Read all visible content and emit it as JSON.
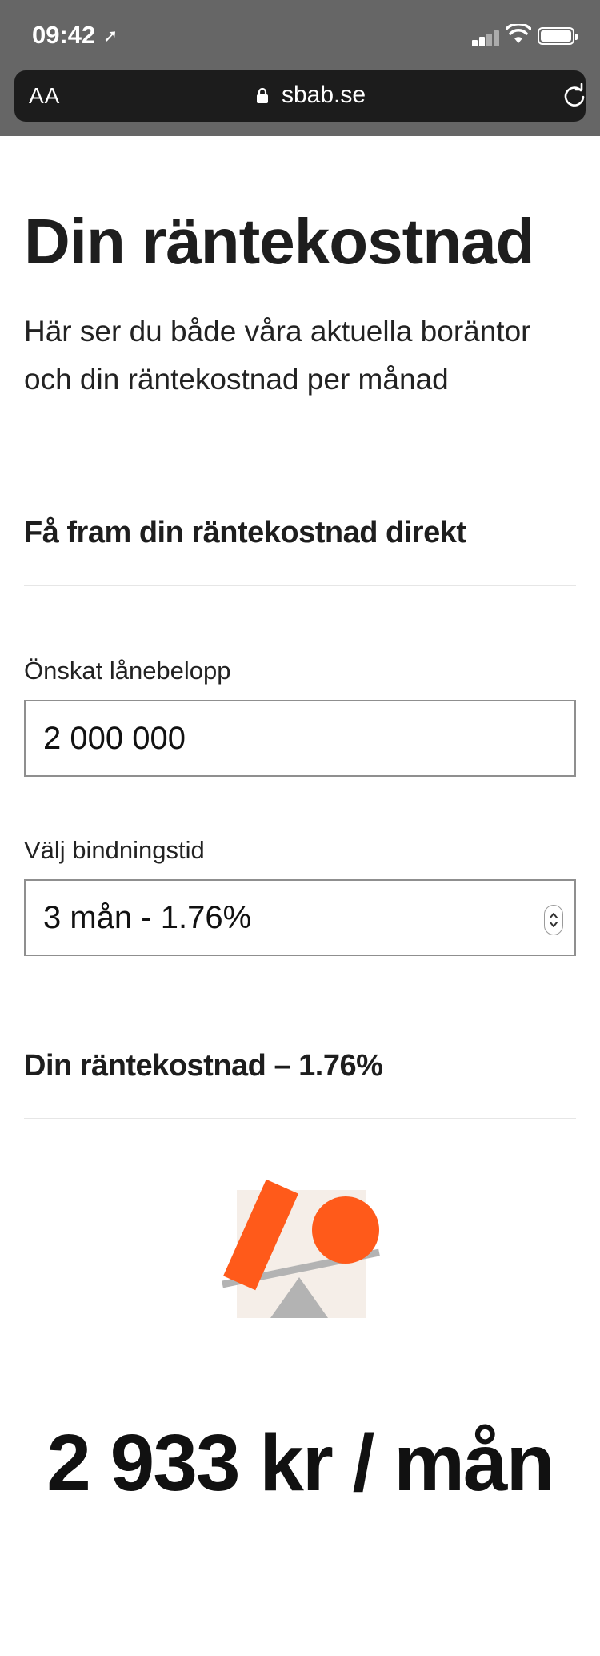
{
  "status_bar": {
    "time": "09:42",
    "location_icon": "location-arrow-icon"
  },
  "browser": {
    "text_size_label": "AA",
    "url": "sbab.se"
  },
  "page": {
    "title": "Din räntekostnad",
    "intro": "Här ser du både våra aktuella boräntor och din räntekostnad per månad",
    "section_heading": "Få fram din räntekostnad direkt",
    "loan_amount": {
      "label": "Önskat lånebelopp",
      "value": "2 000 000"
    },
    "binding_period": {
      "label": "Välj bindningstid",
      "value": "3 mån - 1.76%"
    },
    "result_heading": "Din räntekostnad – 1.76%",
    "monthly_cost": "2 933 kr / mån"
  },
  "colors": {
    "accent": "#ff5a1a",
    "illustration_bg": "#f5eee8",
    "seesaw_grey": "#b3b3b3"
  }
}
